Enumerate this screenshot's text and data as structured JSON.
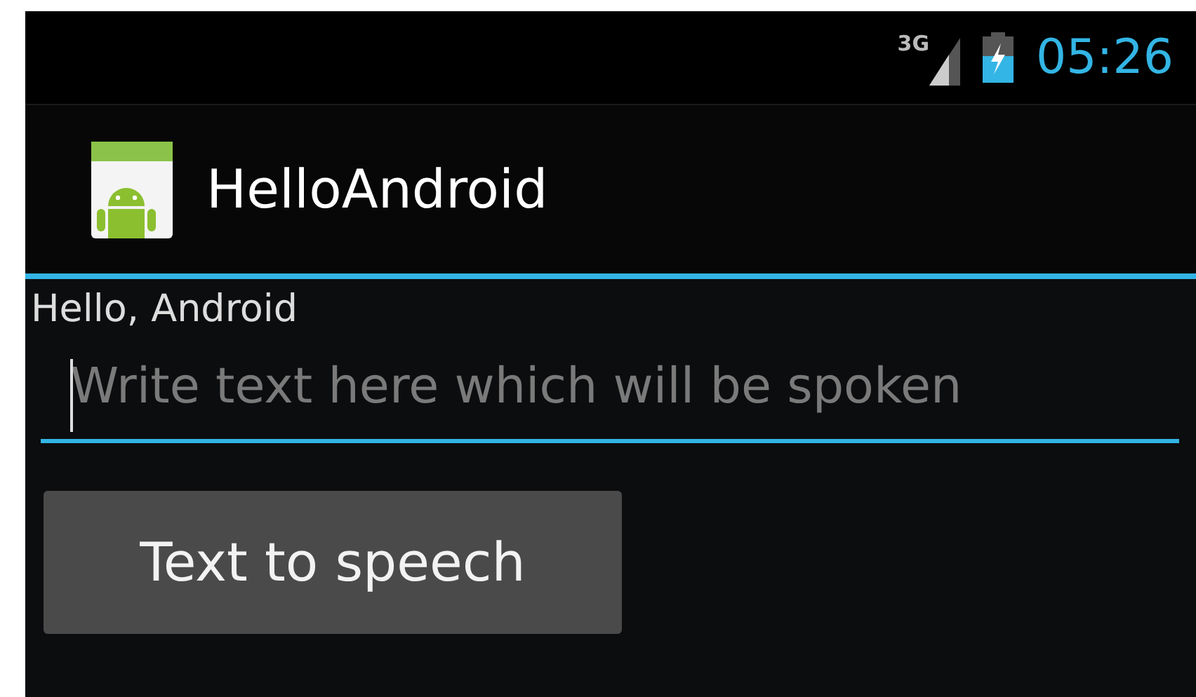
{
  "status_bar": {
    "network": "3G",
    "time": "05:26"
  },
  "action_bar": {
    "title": "HelloAndroid"
  },
  "content": {
    "label": "Hello, Android",
    "input": {
      "placeholder": "Write text here which will be spoken",
      "focused": true
    },
    "button": {
      "label": "Text to speech"
    }
  }
}
